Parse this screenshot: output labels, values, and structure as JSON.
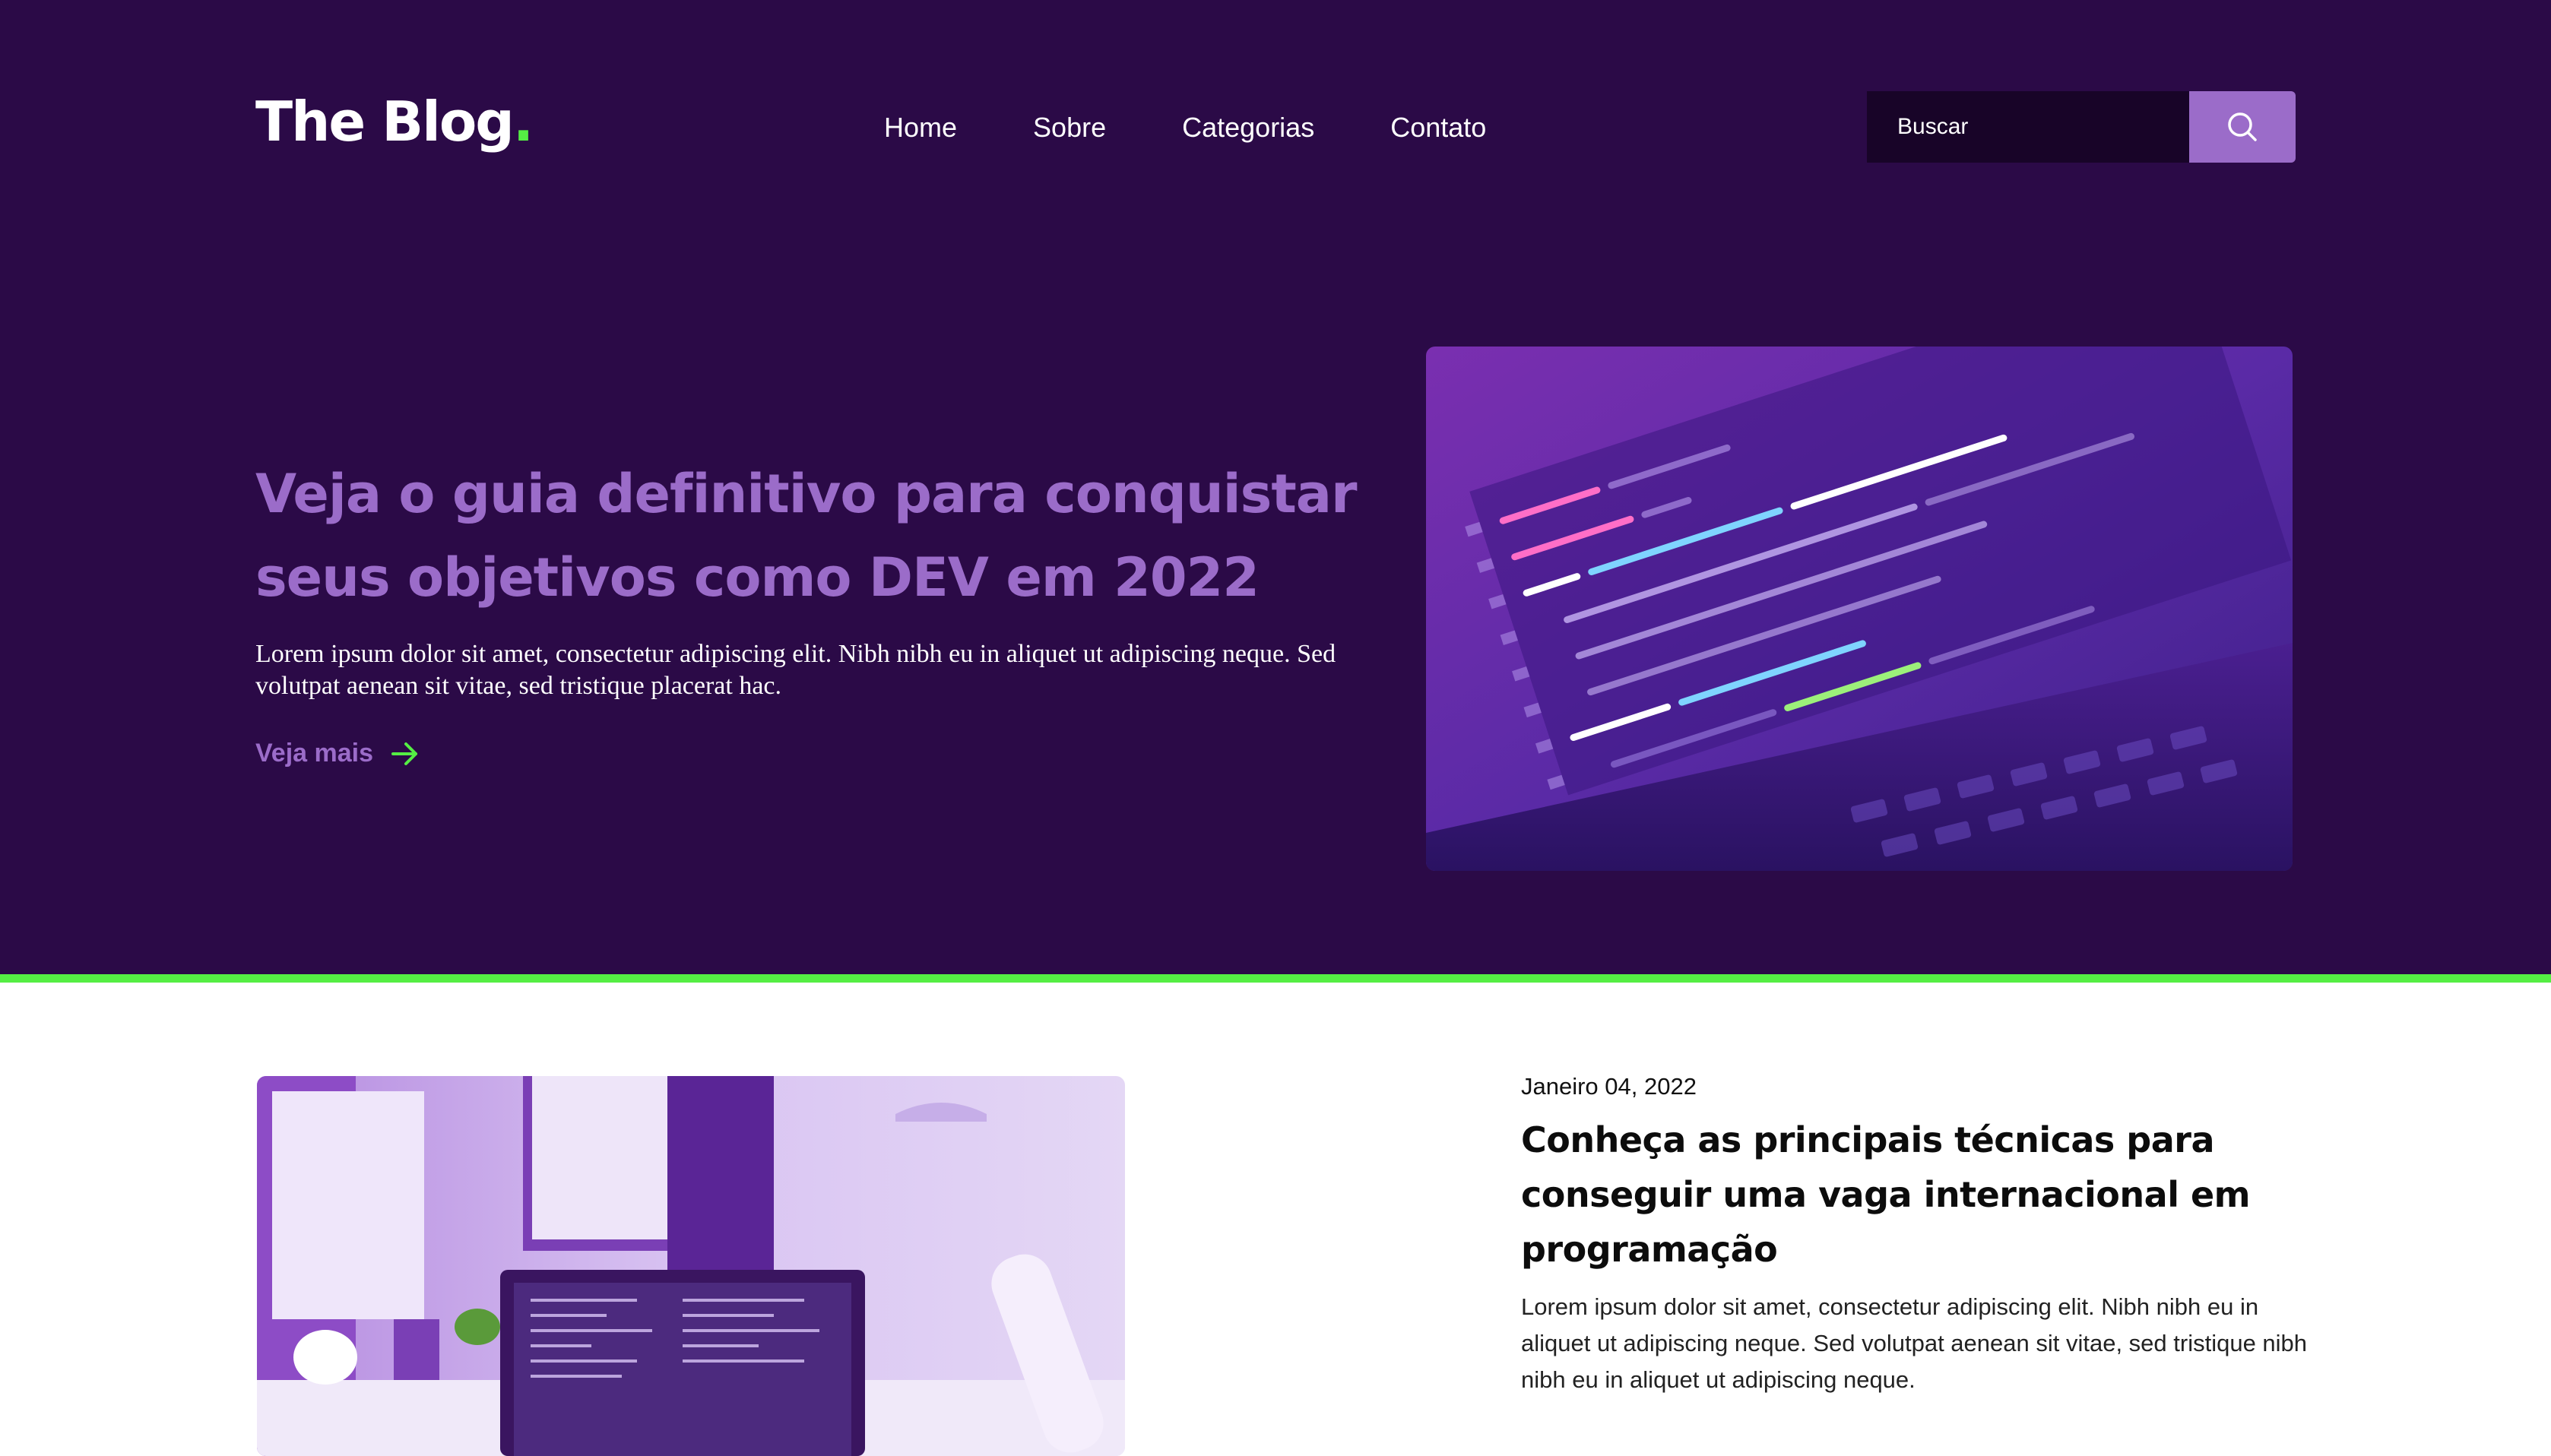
{
  "header": {
    "logo_text": "The Blog",
    "logo_dot": ".",
    "nav": [
      "Home",
      "Sobre",
      "Categorias",
      "Contato"
    ],
    "search_placeholder": "Buscar",
    "search_icon": "search-icon"
  },
  "hero": {
    "title": "Veja o guia definitivo para conquistar seus objetivos como DEV em 2022",
    "text": "Lorem ipsum dolor sit amet, consectetur adipiscing elit. Nibh nibh eu in aliquet ut adipiscing neque. Sed volutpat aenean sit vitae, sed tristique placerat hac.",
    "more_label": "Veja mais",
    "more_icon": "arrow-right-icon"
  },
  "post": {
    "date": "Janeiro 04, 2022",
    "title": "Conheça as principais técnicas para conseguir uma vaga internacional em programação",
    "text": "Lorem ipsum dolor sit amet, consectetur adipiscing elit. Nibh nibh eu in aliquet ut adipiscing neque. Sed volutpat aenean sit vitae, sed tristique nibh nibh eu in aliquet ut adipiscing neque."
  },
  "colors": {
    "hero_bg": "#2b0a47",
    "accent_purple": "#9b6cc9",
    "accent_green": "#55ee44",
    "search_bg": "#180428"
  }
}
